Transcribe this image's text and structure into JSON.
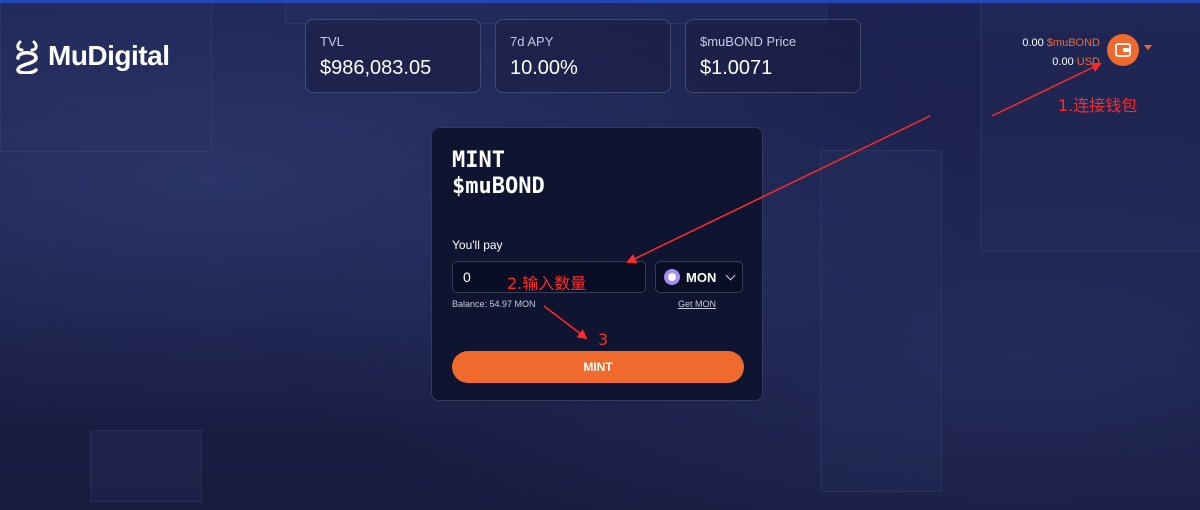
{
  "brand": {
    "name": "MuDigital"
  },
  "stats": [
    {
      "label": "TVL",
      "value": "$986,083.05"
    },
    {
      "label": "7d APY",
      "value": "10.00%"
    },
    {
      "label": "$muBOND Price",
      "value": "$1.0071"
    }
  ],
  "wallet": {
    "bond_amount": "0.00",
    "bond_unit": "$muBOND",
    "usd_amount": "0.00",
    "usd_unit": "USD",
    "icon": "wallet-icon"
  },
  "mint_card": {
    "title_line1": "MINT",
    "title_line2": "$muBOND",
    "pay_label": "You'll pay",
    "amount_value": "0",
    "token": "MON",
    "balance": "Balance: 54.97 MON",
    "get_link": "Get MON",
    "mint_button": "MINT"
  },
  "annotations": {
    "step1": "1.连接钱包",
    "step2": "2.输入数量",
    "step3": "3"
  },
  "colors": {
    "accent": "#f06a2d",
    "annotation": "#ff2a2a",
    "card_bg": "#0f1430"
  }
}
